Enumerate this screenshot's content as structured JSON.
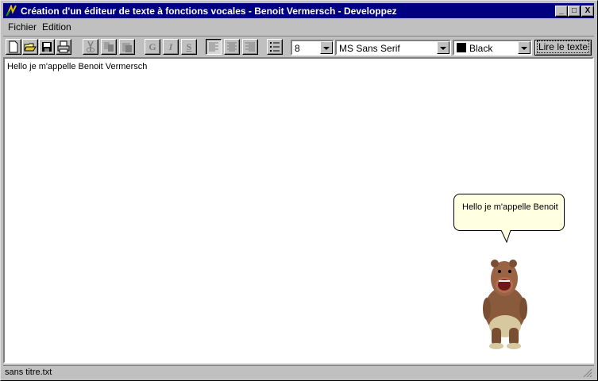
{
  "window": {
    "title": "Création d'un éditeur de texte à fonctions vocales - Benoit Vermersch - Developpez",
    "title_bg": "#000080"
  },
  "controls": {
    "minimize": "_",
    "maximize": "□",
    "close": "X"
  },
  "menu": [
    {
      "label": "Fichier"
    },
    {
      "label": "Edition"
    }
  ],
  "toolbar": {
    "file_buttons": [
      "new-file-icon",
      "open-folder-icon",
      "save-disk-icon",
      "print-icon"
    ],
    "edit_buttons": [
      "cut-scissors-icon",
      "copy-icon",
      "paste-icon"
    ],
    "format_buttons": [
      "G",
      "I",
      "S"
    ],
    "align_buttons": [
      "align-left-icon",
      "align-center-icon",
      "align-right-icon"
    ],
    "list_button": "bullet-list-icon",
    "font_size": "8",
    "font_name": "MS Sans Serif",
    "color_name": "Black",
    "color_value": "#000000",
    "read_label": "Lire le texte"
  },
  "editor": {
    "text": "Hello je m'appelle Benoit Vermersch"
  },
  "agent": {
    "speech": "Hello je m'appelle Benoit",
    "character": "bear-agent-icon"
  },
  "status": {
    "filename": "sans titre.txt"
  }
}
